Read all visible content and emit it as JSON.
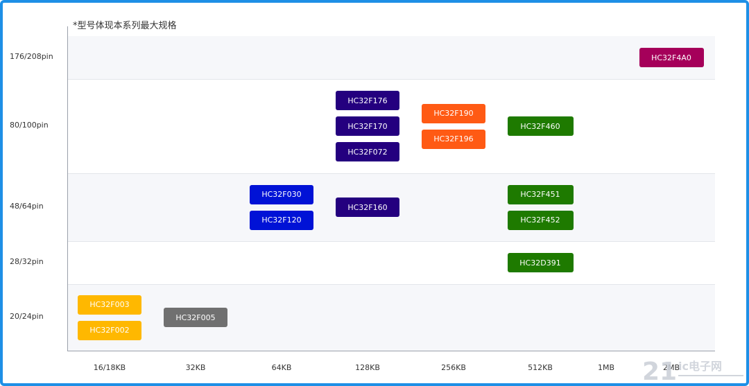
{
  "note": "*型号体现本系列最大规格",
  "colors": {
    "frame": "#1e8fe6",
    "dark_indigo": "#24007f",
    "blue": "#0012d6",
    "orange": "#ff5a14",
    "green": "#1e7a00",
    "amber": "#ffb800",
    "gray": "#707070",
    "magenta": "#a5005a"
  },
  "y_categories": [
    "176/208pin",
    "80/100pin",
    "48/64pin",
    "28/32pin",
    "20/24pin"
  ],
  "x_categories": [
    "16/18KB",
    "32KB",
    "64KB",
    "128KB",
    "256KB",
    "512KB",
    "1MB",
    "2MB"
  ],
  "chips": [
    {
      "label": "HC32F4A0",
      "pins": "176/208pin",
      "flash": "2MB",
      "color": "magenta"
    },
    {
      "label": "HC32F176",
      "pins": "80/100pin",
      "flash": "128KB",
      "color": "dark_indigo"
    },
    {
      "label": "HC32F170",
      "pins": "80/100pin",
      "flash": "128KB",
      "color": "dark_indigo"
    },
    {
      "label": "HC32F072",
      "pins": "80/100pin",
      "flash": "128KB",
      "color": "dark_indigo"
    },
    {
      "label": "HC32F190",
      "pins": "80/100pin",
      "flash": "256KB",
      "color": "orange"
    },
    {
      "label": "HC32F196",
      "pins": "80/100pin",
      "flash": "256KB",
      "color": "orange"
    },
    {
      "label": "HC32F460",
      "pins": "80/100pin",
      "flash": "512KB",
      "color": "green"
    },
    {
      "label": "HC32F030",
      "pins": "48/64pin",
      "flash": "64KB",
      "color": "blue"
    },
    {
      "label": "HC32F120",
      "pins": "48/64pin",
      "flash": "64KB",
      "color": "blue"
    },
    {
      "label": "HC32F160",
      "pins": "48/64pin",
      "flash": "128KB",
      "color": "dark_indigo"
    },
    {
      "label": "HC32F451",
      "pins": "48/64pin",
      "flash": "512KB",
      "color": "green"
    },
    {
      "label": "HC32F452",
      "pins": "48/64pin",
      "flash": "512KB",
      "color": "green"
    },
    {
      "label": "HC32D391",
      "pins": "28/32pin",
      "flash": "512KB",
      "color": "green"
    },
    {
      "label": "HC32F003",
      "pins": "20/24pin",
      "flash": "16/18KB",
      "color": "amber"
    },
    {
      "label": "HC32F002",
      "pins": "20/24pin",
      "flash": "16/18KB",
      "color": "amber"
    },
    {
      "label": "HC32F005",
      "pins": "20/24pin",
      "flash": "32KB",
      "color": "gray"
    }
  ],
  "watermark": {
    "brand_number": "21",
    "brand_text": "ic电子网"
  }
}
